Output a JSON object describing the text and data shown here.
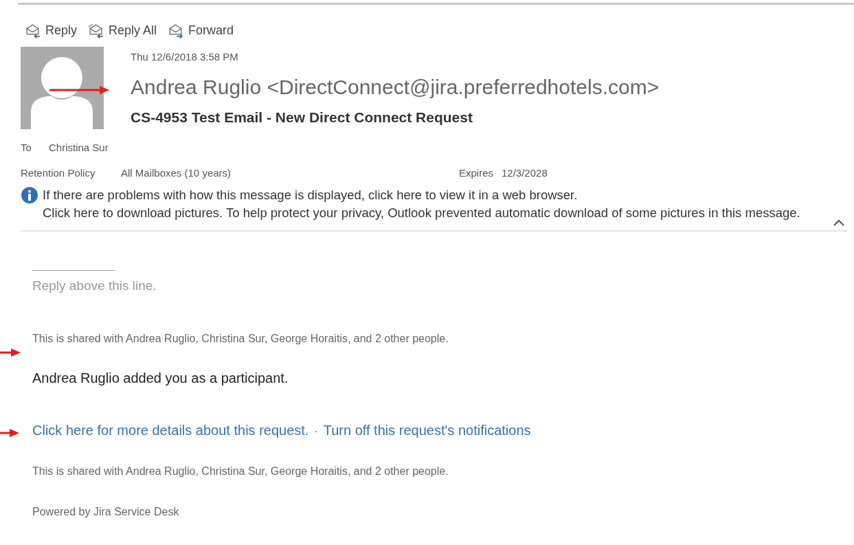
{
  "toolbar": [
    {
      "kind": "reply",
      "label": "Reply"
    },
    {
      "kind": "reply_all",
      "label": "Reply All"
    },
    {
      "kind": "forward",
      "label": "Forward"
    }
  ],
  "header": {
    "date": "Thu 12/6/2018 3:58 PM",
    "sender": "Andrea Ruglio <DirectConnect@jira.preferredhotels.com>",
    "subject": "CS-4953 Test Email - New Direct Connect Request",
    "to_label": "To",
    "to": "Christina Sur",
    "retention_label": "Retention Policy",
    "retention": "All Mailboxes (10 years)",
    "expires_label": "Expires",
    "expires": "12/3/2028"
  },
  "info": {
    "line_1": "If there are problems with how this message is displayed, click here to view it in a web browser.",
    "line_2": "Click here to download pictures. To help protect your privacy, Outlook prevented automatic download of some pictures in this message."
  },
  "body": {
    "reply_hint": "Reply above this line.",
    "shared_top": "This is shared with Andrea Ruglio, Christina Sur, George Horaitis, and 2 other people.",
    "added": "Andrea Ruglio added you as a participant.",
    "links": [
      "Click here for more details about this request.",
      "Turn off this request's notifications"
    ],
    "link_separator": "·",
    "shared_bottom": "This is shared with Andrea Ruglio, Christina Sur, George Horaitis, and 2 other people.",
    "footer": "Powered by Jira Service Desk"
  }
}
